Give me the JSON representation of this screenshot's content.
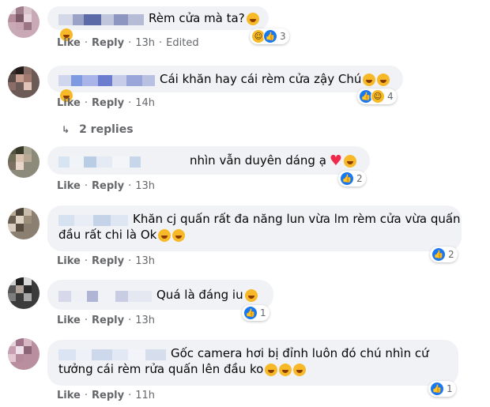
{
  "comments": [
    {
      "text": "Rèm cửa mà ta?",
      "actions": {
        "like": "Like",
        "reply": "Reply",
        "time": "13h",
        "edited": "Edited"
      },
      "reactions": {
        "count": "3"
      }
    },
    {
      "text": "Cái khăn hay cái rèm cửa zậy Chú",
      "actions": {
        "like": "Like",
        "reply": "Reply",
        "time": "14h"
      },
      "reactions": {
        "count": "4"
      }
    },
    {
      "text": "nhìn vẫn duyên dáng ạ",
      "actions": {
        "like": "Like",
        "reply": "Reply",
        "time": "13h"
      },
      "reactions": {
        "count": "2"
      }
    },
    {
      "text_line1": "Khăn cj quấn rất đa năng lun vừa lm rèm cửa vừa quấn",
      "text_line2": "đầu rất chi là Ok",
      "actions": {
        "like": "Like",
        "reply": "Reply",
        "time": "13h"
      },
      "reactions": {
        "count": "2"
      }
    },
    {
      "text": "Quá là đáng iu",
      "actions": {
        "like": "Like",
        "reply": "Reply",
        "time": "13h"
      },
      "reactions": {
        "count": "1"
      }
    },
    {
      "text_line1": "Gốc camera hơi bị đỉnh luôn đó chú nhìn cứ",
      "text_line2": "tưởng cái rèm rửa quấn lên đầu ko",
      "actions": {
        "like": "Like",
        "reply": "Reply",
        "time": "11h"
      },
      "reactions": {
        "count": "1"
      }
    }
  ],
  "replies_link": "2 replies",
  "colors": {
    "bubble": "#f0f2f5",
    "meta": "#65676b",
    "like": "#1877f2",
    "haha": "#f7b928",
    "heart": "#f02849"
  }
}
